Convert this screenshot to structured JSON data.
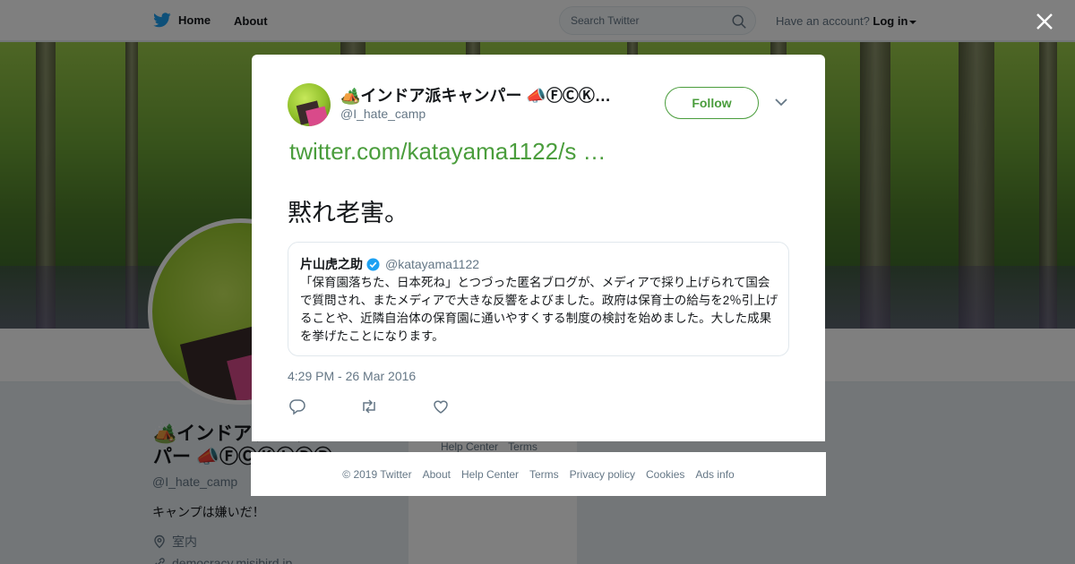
{
  "topbar": {
    "home_label": "Home",
    "about_label": "About",
    "search_placeholder": "Search Twitter",
    "account_prompt": "Have an account?",
    "login_label": "Log in"
  },
  "profile": {
    "name": "🏕️インドア派キャンパー 📣ⒻⒸⓀⓁⒹⓅ",
    "handle": "@I_hate_camp",
    "bio": "キャンプは嫌いだ！",
    "location": "室内",
    "website": "democracy.misibird.jp"
  },
  "side_links": [
    "Help Center",
    "Terms"
  ],
  "tweet": {
    "author_name": "🏕️インドア派キャンパー 📣ⒻⒸⓀ…",
    "author_handle": "@I_hate_camp",
    "follow_label": "Follow",
    "link_text": "twitter.com/katayama1122/s …",
    "text": "黙れ老害。",
    "quote": {
      "name": "片山虎之助",
      "handle": "@katayama1122",
      "verified": true,
      "text": "「保育園落ちた、日本死ね」とつづった匿名ブログが、メディアで採り上げられて国会で質問され、またメディアで大きな反響をよびました。政府は保育士の給与を2％引上げることや、近隣自治体の保育園に通いやすくする制度の検討を始めました。大した成果を挙げたことになります。"
    },
    "timestamp": "4:29 PM - 26 Mar 2016"
  },
  "footer": {
    "links": [
      "© 2019 Twitter",
      "About",
      "Help Center",
      "Terms",
      "Privacy policy",
      "Cookies",
      "Ads info"
    ]
  },
  "colors": {
    "accent": "#4a9d3c",
    "twitter_blue": "#1da1f2",
    "text_secondary": "#657786"
  }
}
